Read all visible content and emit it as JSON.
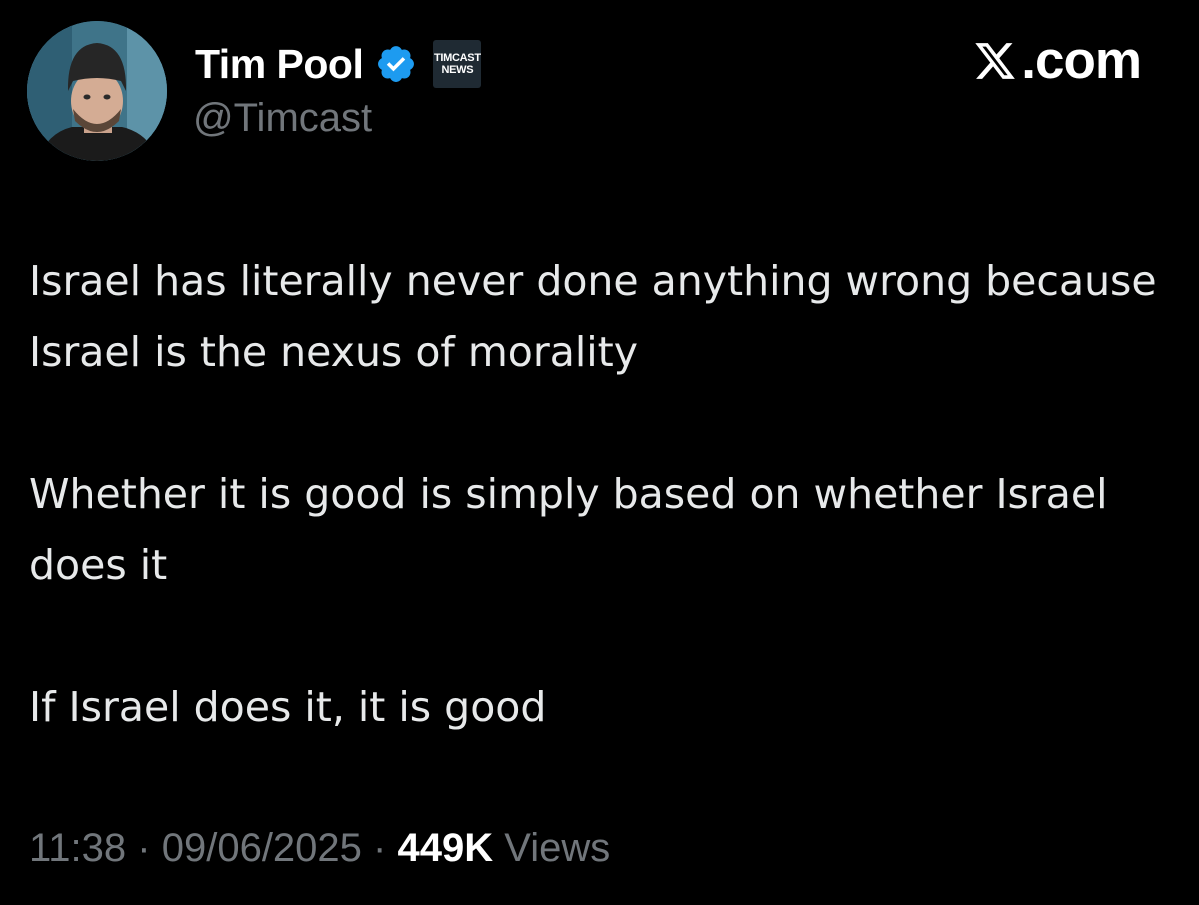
{
  "author": {
    "display_name": "Tim Pool",
    "handle": "@Timcast",
    "verified_icon": "verified-check-icon",
    "affiliate_badge": {
      "line1": "TIMCAST",
      "line2": "NEWS"
    }
  },
  "brand": {
    "label": ".com",
    "icon": "x-logo-icon"
  },
  "tweet": {
    "paragraphs": [
      "Israel has literally never done anything wrong because Israel is the nexus of morality",
      "Whether it is good is simply based on whether Israel does it",
      "If Israel does it, it is good"
    ]
  },
  "meta": {
    "time": "11:38",
    "separator": "·",
    "date": "09/06/2025",
    "views_count": "449K",
    "views_label": "Views"
  },
  "colors": {
    "background": "#000000",
    "text": "#e7e9ea",
    "secondary": "#71767b",
    "verified": "#1d9bf0"
  }
}
